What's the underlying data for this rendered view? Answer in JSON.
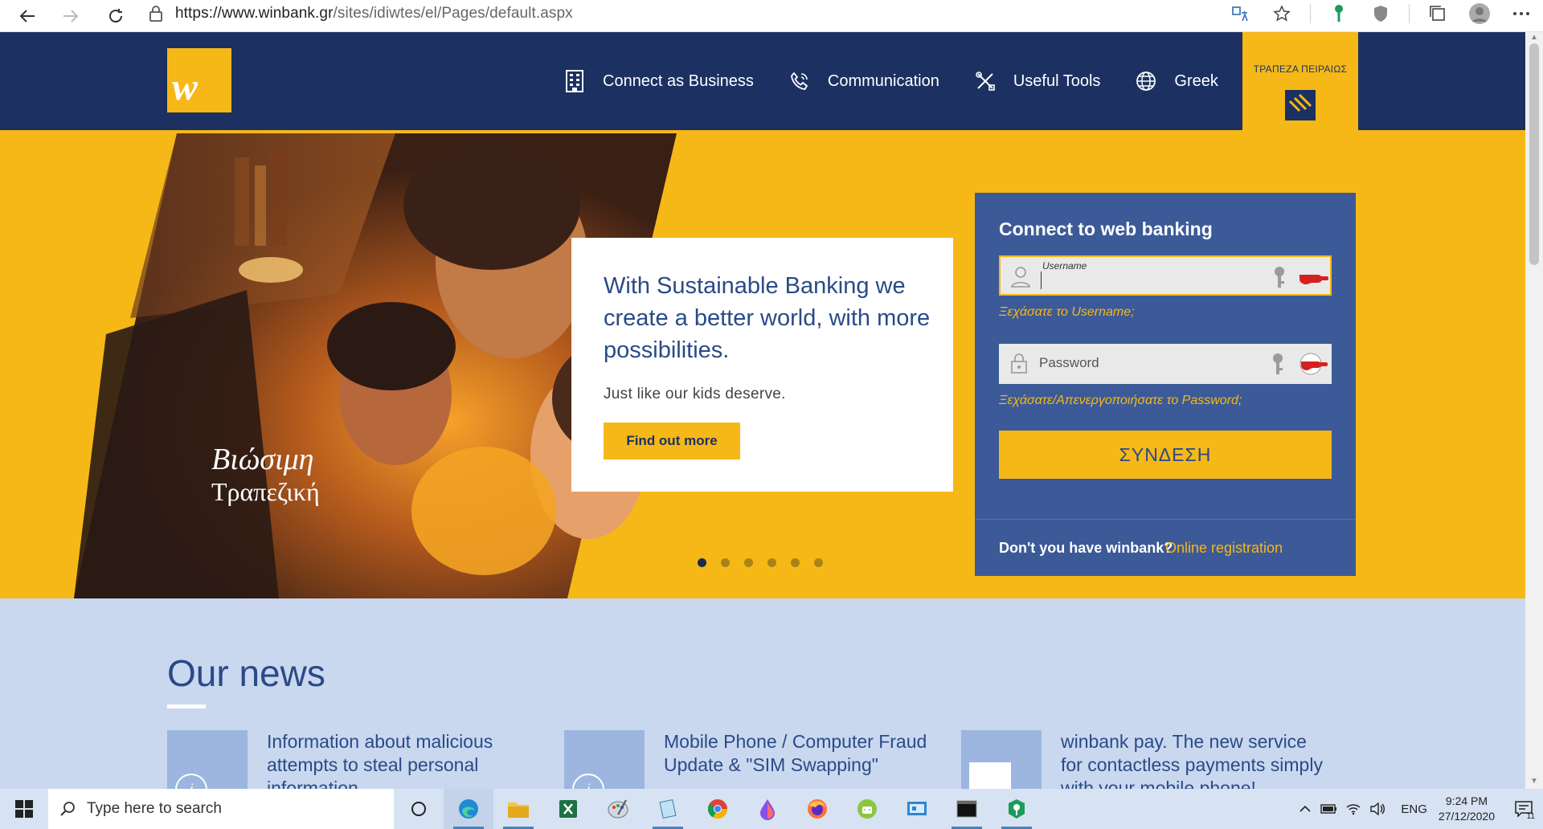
{
  "browser": {
    "url_host": "https://www.winbank.gr",
    "url_path": "/sites/idiwtes/el/Pages/default.aspx"
  },
  "header": {
    "logo_letter": "w",
    "nav": [
      {
        "label": "Connect as Business",
        "icon": "building-icon"
      },
      {
        "label": "Communication",
        "icon": "phone-icon"
      },
      {
        "label": "Useful Tools",
        "icon": "tools-icon"
      },
      {
        "label": "Greek",
        "icon": "globe-icon"
      }
    ],
    "piraeus_label": "ΤΡΑΠΕΖΑ ΠΕΙΡΑΙΩΣ"
  },
  "hero": {
    "script_line1": "Βιώσιμη",
    "script_line2": "Τραπεζική",
    "title": "With Sustainable Banking we create a better world, with more possibilities.",
    "subtitle": "Just like our kids deserve.",
    "cta": "Find out more",
    "slide_count": 6,
    "active_slide": 1
  },
  "login": {
    "title": "Connect to web banking",
    "username_label": "Username",
    "forgot_username": "Ξεχάσατε το Username;",
    "password_placeholder": "Password",
    "forgot_password": "Ξεχάσατε/Απενεργοποιήσατε το Password;",
    "submit": "ΣΥΝΔΕΣΗ",
    "register_question": "Don't you have winbank?",
    "register_link": "Online registration"
  },
  "news": {
    "title": "Our news",
    "items": [
      {
        "text": "Information about malicious attempts to steal personal information"
      },
      {
        "text": "Mobile Phone / Computer Fraud Update & \"SIM Swapping\""
      },
      {
        "text": "winbank pay. The new service for contactless payments simply with your mobile phone!"
      }
    ]
  },
  "taskbar": {
    "search_placeholder": "Type here to search",
    "language": "ENG",
    "time": "9:24 PM",
    "date": "27/12/2020",
    "notifications": "11"
  },
  "colors": {
    "navy": "#1c3162",
    "yellow": "#f6b817",
    "panel_blue": "#3c5a98",
    "news_bg": "#c9d8ef"
  }
}
